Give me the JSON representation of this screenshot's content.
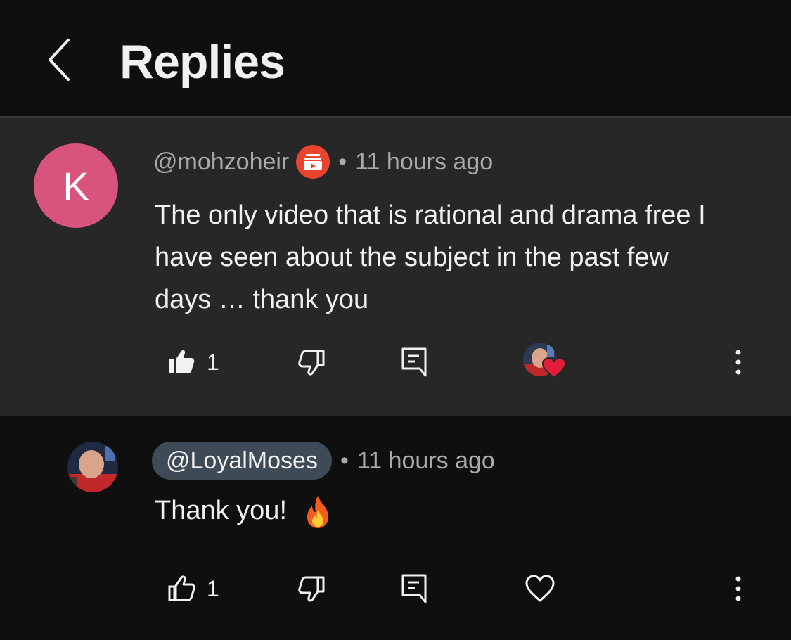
{
  "header": {
    "title": "Replies",
    "back_icon": "chevron-left-icon"
  },
  "parent_comment": {
    "avatar_letter": "K",
    "avatar_color": "#d9547c",
    "author": "@mohzoheir",
    "separator": "•",
    "timestamp": "11 hours ago",
    "text": "The only video that is rational and drama free I have seen about the subject in the past few days … thank you",
    "like_count": "1",
    "creator_heart": true
  },
  "reply": {
    "author": "@LoyalMoses",
    "separator": "•",
    "timestamp": "11 hours ago",
    "text": "Thank you!",
    "emoji": "fire-emoji",
    "like_count": "1"
  },
  "colors": {
    "background": "#0f0f0f",
    "highlight_background": "#272727",
    "member_badge": "#e8442e",
    "heart": "#e31d37",
    "author_pill": "#3e4a56"
  }
}
